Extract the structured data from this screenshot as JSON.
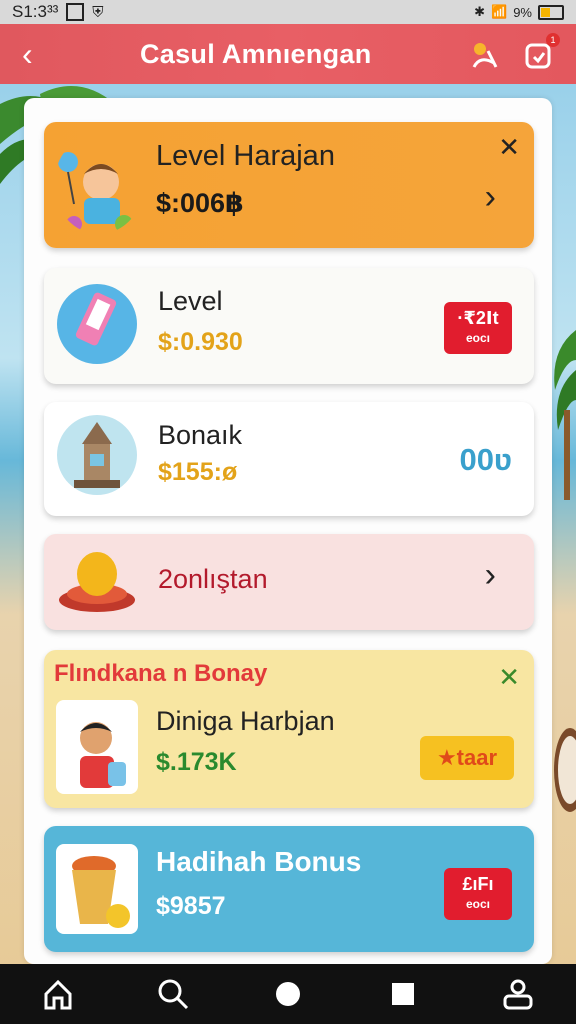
{
  "status": {
    "time": "S1:3³³",
    "battery": "9%"
  },
  "header": {
    "title": "Casul Amnıengan"
  },
  "cards": [
    {
      "title": "Level Harajan",
      "value": "$:006฿"
    },
    {
      "title": "Level",
      "value": "$:0.930",
      "badge_top": "·₹2Ⅰt",
      "badge_bottom": "eocı"
    },
    {
      "title": "Bonaık",
      "value": "$155:ø",
      "amount": "00ʋ"
    },
    {
      "title": "2onlıştan"
    },
    {
      "banner": "Flındkana n Bonay",
      "title": "Diniga Harbjan",
      "value": "$.173K",
      "button": "★taar"
    },
    {
      "title": "Hadihah Bonus",
      "value": "$9857",
      "badge_top": "£ıFı",
      "badge_bottom": "eocı"
    }
  ],
  "colors": {
    "header": "#e0585e",
    "orange": "#f3a233",
    "pink": "#f9e0e0",
    "yellow": "#f8e7a3",
    "blue": "#57b7d8",
    "red": "#e11d2e"
  }
}
